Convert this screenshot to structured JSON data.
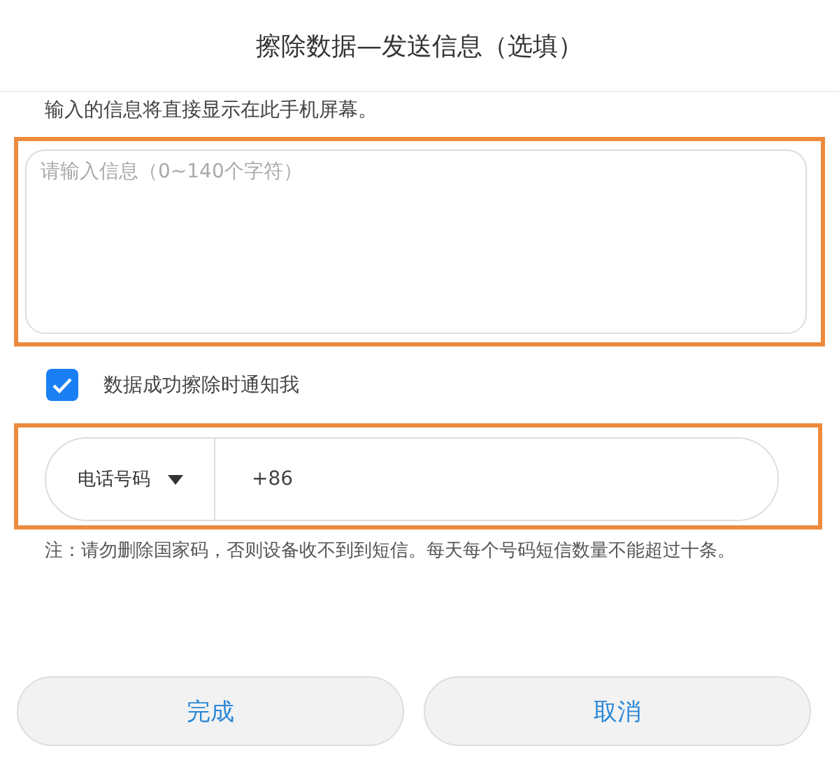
{
  "dialog": {
    "title": "擦除数据—发送信息（选填）"
  },
  "description": "输入的信息将直接显示在此手机屏幕。",
  "message": {
    "placeholder": "请输入信息（0~140个字符）"
  },
  "notify": {
    "label": "数据成功擦除时通知我",
    "checked": true
  },
  "phone": {
    "type_label": "电话号码",
    "value": "+86"
  },
  "note": "注：请勿删除国家码，否则设备收不到到短信。每天每个号码短信数量不能超过十条。",
  "buttons": [
    {
      "label": "完成"
    },
    {
      "label": "取消"
    }
  ]
}
